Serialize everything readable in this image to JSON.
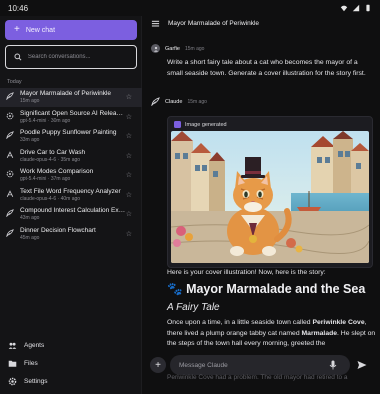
{
  "status": {
    "time": "10:46"
  },
  "sidebar": {
    "new_chat_label": "New chat",
    "search_placeholder": "Search conversations...",
    "section_today": "Today",
    "conversations": [
      {
        "title": "Mayor Marmalade of Periwinkle",
        "sub": "15m ago",
        "icon": "quill-icon",
        "active": true
      },
      {
        "title": "Significant Open Source AI Releases",
        "sub": "gpt-5.4-mini · 30m ago",
        "icon": "openai-icon"
      },
      {
        "title": "Poodle Puppy Sunflower Painting",
        "sub": "33m ago",
        "icon": "quill-icon"
      },
      {
        "title": "Drive Car to Car Wash",
        "sub": "claude-opus-4-6 · 35m ago",
        "icon": "claude-icon"
      },
      {
        "title": "Work Modes Comparison",
        "sub": "gpt-5.4-mini · 37m ago",
        "icon": "openai-icon"
      },
      {
        "title": "Text File Word Frequency Analyzer",
        "sub": "claude-opus-4-6 · 40m ago",
        "icon": "claude-icon"
      },
      {
        "title": "Compound Interest Calculation Exa...",
        "sub": "43m ago",
        "icon": "quill-icon"
      },
      {
        "title": "Dinner Decision Flowchart",
        "sub": "45m ago",
        "icon": "quill-icon"
      }
    ],
    "bottom": {
      "agents": "Agents",
      "files": "Files",
      "settings": "Settings"
    }
  },
  "main": {
    "title": "Mayor Marmalade of Periwinkle",
    "user": {
      "name": "Garfie",
      "time": "15m ago",
      "text": "Write a short fairy tale about a cat who becomes the mayor of a small seaside town. Generate a cover illustration for the story first."
    },
    "assistant": {
      "name": "Claude",
      "time": "15m ago",
      "image_label": "Image generated",
      "intro": "Here is your cover illustration! Now, here is the story:",
      "heading_emoji": "🐾",
      "heading": "Mayor Marmalade and the Sea",
      "subheading": "A Fairy Tale",
      "story_p1_a": "Once upon a time, in a little seaside town called ",
      "story_p1_b": "Periwinkle Cove",
      "story_p1_c": ", there lived a plump orange tabby cat named ",
      "story_p1_d": "Marmalade",
      "story_p1_e": ". He slept on the steps of the town hall every morning, greeted the",
      "story_p2": "Periwinkle Cove had a problem. The old mayor had retired to a"
    },
    "input_placeholder": "Message Claude"
  },
  "colors": {
    "accent": "#7c5fe0",
    "background": "#0f0f10",
    "sidebar": "#141416"
  }
}
